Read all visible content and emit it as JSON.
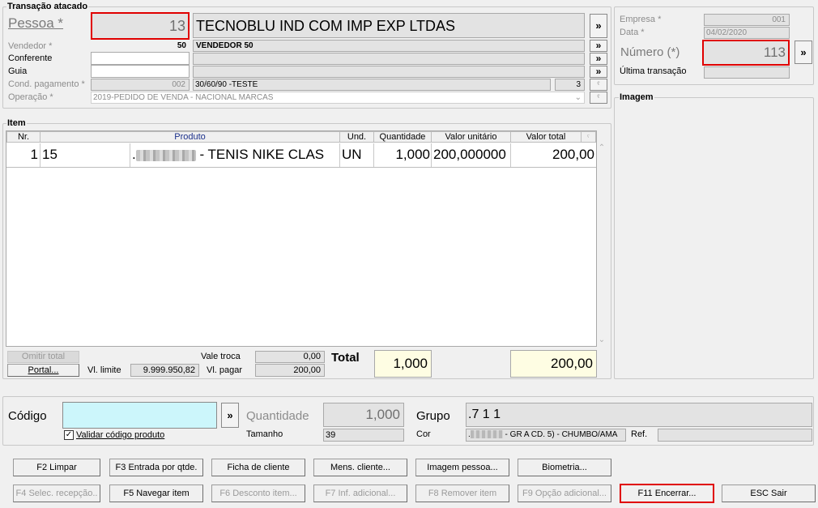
{
  "transacao": {
    "title": "Transação atacado",
    "pessoa_label": "Pessoa *",
    "pessoa_code": "13",
    "pessoa_name": "TECNOBLU IND  COM  IMP  EXP  LTDAS",
    "vendedor_label": "Vendedor *",
    "vendedor_code": "50",
    "vendedor_name": "VENDEDOR 50",
    "conferente_label": "Conferente",
    "conferente_value": "",
    "guia_label": "Guia",
    "guia_value": "",
    "cond_label": "Cond. pagamento *",
    "cond_code": "002",
    "cond_name": "30/60/90 -TESTE",
    "cond_count": "3",
    "operacao_label": "Operação *",
    "operacao_value": "2019-PEDIDO DE VENDA - NACIONAL MARCAS",
    "arrow": "»"
  },
  "empresa": {
    "empresa_label": "Empresa *",
    "empresa_value": "001",
    "data_label": "Data *",
    "data_value": "04/02/2020",
    "numero_label": "Número (*)",
    "numero_value": "113",
    "ultima_label": "Última transação",
    "ultima_value": ""
  },
  "imagem": {
    "title": "Imagem"
  },
  "item": {
    "title": "Item",
    "columns": [
      "Nr.",
      "Produto",
      "Und.",
      "Quantidade",
      "Valor unitário",
      "Valor total"
    ],
    "rows": [
      {
        "nr": "1",
        "codigo": "15",
        "produto": " - TENIS NIKE CLAS",
        "und": "UN",
        "quantidade": "1,000",
        "valor_unitario": "200,000000",
        "valor_total": "200,00"
      }
    ]
  },
  "totals": {
    "omitir_total": "Omitir total",
    "portal": "Portal...",
    "vl_limite_label": "Vl. limite",
    "vl_limite_value": "9.999.950,82",
    "vale_troca_label": "Vale troca",
    "vale_troca_value": "0,00",
    "vl_pagar_label": "Vl. pagar",
    "vl_pagar_value": "200,00",
    "total_label": "Total",
    "total_quantidade": "1,000",
    "total_valor": "200,00"
  },
  "entry": {
    "codigo_label": "Código",
    "codigo_value": "",
    "validar_label": "Validar código produto",
    "validar_checked": true,
    "quantidade_label": "Quantidade",
    "quantidade_value": "1,000",
    "tamanho_label": "Tamanho",
    "tamanho_value": "39",
    "grupo_label": "Grupo",
    "grupo_value": ".7 1 1",
    "cor_label": "Cor",
    "cor_value": " - GR A CD. 5) - CHUMBO/AMA",
    "ref_label": "Ref.",
    "ref_value": ""
  },
  "buttons_row1": [
    "F2 Limpar",
    "F3 Entrada por qtde.",
    "Ficha de cliente",
    "Mens. cliente...",
    "Imagem pessoa...",
    "Biometria..."
  ],
  "buttons_row2": [
    "F4 Selec. recepção..",
    "F5 Navegar item",
    "F6 Desconto item...",
    "F7 Inf. adicional...",
    "F8 Remover item",
    "F9 Opção adicional...",
    "F11 Encerrar...",
    "ESC Sair"
  ],
  "colors": {
    "highlight_red": "#e00000",
    "codigo_bg": "#ccf6fb",
    "total_bg": "#fefde3"
  }
}
